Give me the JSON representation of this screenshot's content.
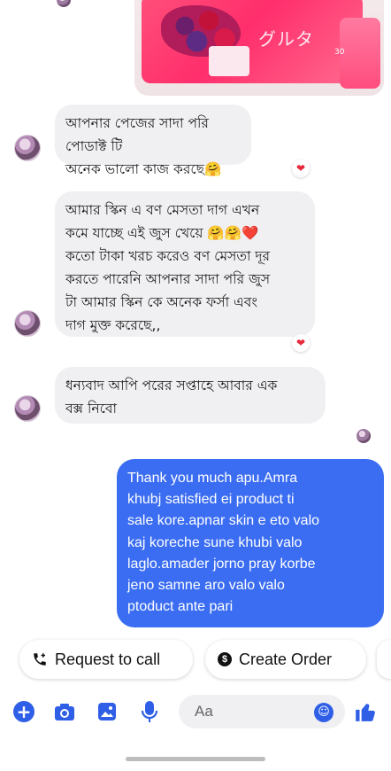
{
  "product_image": {
    "brand_text": "グルタ",
    "count_text": "30"
  },
  "messages": [
    {
      "direction": "incoming",
      "lines": [
        "আপনার পেজের সাদা পরি পোডাক্ট টি",
        "অনেক ভালো কাজ করছে🤗"
      ],
      "reaction": "❤"
    },
    {
      "direction": "incoming",
      "lines": [
        "আমার স্কিন এ বণ মেসতা দাগ এখন",
        "কমে যাচ্ছে এই জুস খেয়ে 🤗🤗❤️",
        "কতো টাকা খরচ করেও বণ মেসতা দূর",
        "করতে পারেনি আপনার সাদা পরি জুস",
        "টা আমার স্কিন কে অনেক ফর্সা এবং",
        "দাগ মুক্ত করেছে,,"
      ],
      "reaction": "❤"
    },
    {
      "direction": "incoming",
      "lines": [
        "ধন্যবাদ আপি পরের সপ্তাহে আবার এক",
        "বক্স নিবো"
      ]
    },
    {
      "direction": "outgoing",
      "lines": [
        "Thank you much apu.Amra",
        "khubj satisfied ei product ti",
        "sale kore.apnar skin e eto valo",
        "kaj koreche sune khubi valo",
        "laglo.amader jorno pray korbe",
        "jeno samne aro valo valo",
        "ptoduct ante pari"
      ]
    }
  ],
  "quick_replies": {
    "request_call": "Request to call",
    "create_order": "Create Order",
    "create_order_icon": "$"
  },
  "composer": {
    "placeholder": "Aa",
    "icons": [
      "plus-icon",
      "camera-icon",
      "image-icon",
      "microphone-icon",
      "emoji-icon",
      "thumbs-up-icon"
    ]
  },
  "colors": {
    "accent": "#2f5fe6",
    "outgoing_bubble": "#3b6df2",
    "incoming_bubble": "#f0f0f2",
    "heart": "#e5283a"
  }
}
